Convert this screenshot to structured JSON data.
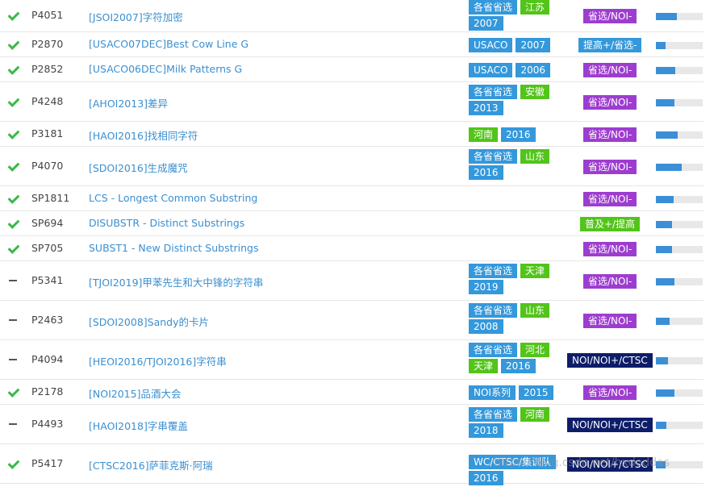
{
  "rows": [
    {
      "status": "solved",
      "id": "P4051",
      "title": "[JSOI2007]字符加密",
      "tags": [
        {
          "text": "各省省选",
          "color": "#3498db"
        },
        {
          "text": "江苏",
          "color": "#52c41a"
        },
        {
          "text": "2007",
          "color": "#3498db"
        }
      ],
      "difficulty": {
        "text": "省选/NOI-",
        "color": "#9d3dcf"
      },
      "progress": 0.45
    },
    {
      "status": "solved",
      "id": "P2870",
      "title": "[USACO07DEC]Best Cow Line G",
      "tags": [
        {
          "text": "USACO",
          "color": "#3498db"
        },
        {
          "text": "2007",
          "color": "#3498db"
        }
      ],
      "difficulty": {
        "text": "提高+/省选-",
        "color": "#3498db"
      },
      "progress": 0.2
    },
    {
      "status": "solved",
      "id": "P2852",
      "title": "[USACO06DEC]Milk Patterns G",
      "tags": [
        {
          "text": "USACO",
          "color": "#3498db"
        },
        {
          "text": "2006",
          "color": "#3498db"
        }
      ],
      "difficulty": {
        "text": "省选/NOI-",
        "color": "#9d3dcf"
      },
      "progress": 0.42
    },
    {
      "status": "solved",
      "id": "P4248",
      "title": "[AHOI2013]差异",
      "tags": [
        {
          "text": "各省省选",
          "color": "#3498db"
        },
        {
          "text": "安徽",
          "color": "#52c41a"
        },
        {
          "text": "2013",
          "color": "#3498db"
        }
      ],
      "difficulty": {
        "text": "省选/NOI-",
        "color": "#9d3dcf"
      },
      "progress": 0.4
    },
    {
      "status": "solved",
      "id": "P3181",
      "title": "[HAOI2016]找相同字符",
      "tags": [
        {
          "text": "河南",
          "color": "#52c41a"
        },
        {
          "text": "2016",
          "color": "#3498db"
        }
      ],
      "difficulty": {
        "text": "省选/NOI-",
        "color": "#9d3dcf"
      },
      "progress": 0.46
    },
    {
      "status": "solved",
      "id": "P4070",
      "title": "[SDOI2016]生成魔咒",
      "tags": [
        {
          "text": "各省省选",
          "color": "#3498db"
        },
        {
          "text": "山东",
          "color": "#52c41a"
        },
        {
          "text": "2016",
          "color": "#3498db"
        }
      ],
      "difficulty": {
        "text": "省选/NOI-",
        "color": "#9d3dcf"
      },
      "progress": 0.55
    },
    {
      "status": "solved",
      "id": "SP1811",
      "title": "LCS - Longest Common Substring",
      "tags": [],
      "difficulty": {
        "text": "省选/NOI-",
        "color": "#9d3dcf"
      },
      "progress": 0.38
    },
    {
      "status": "solved",
      "id": "SP694",
      "title": "DISUBSTR - Distinct Substrings",
      "tags": [],
      "difficulty": {
        "text": "普及+/提高",
        "color": "#52c41a"
      },
      "progress": 0.35
    },
    {
      "status": "solved",
      "id": "SP705",
      "title": "SUBST1 - New Distinct Substrings",
      "tags": [],
      "difficulty": {
        "text": "省选/NOI-",
        "color": "#9d3dcf"
      },
      "progress": 0.35
    },
    {
      "status": "pending",
      "id": "P5341",
      "title": "[TJOI2019]甲苯先生和大中锋的字符串",
      "tags": [
        {
          "text": "各省省选",
          "color": "#3498db"
        },
        {
          "text": "天津",
          "color": "#52c41a"
        },
        {
          "text": "2019",
          "color": "#3498db"
        }
      ],
      "difficulty": {
        "text": "省选/NOI-",
        "color": "#9d3dcf"
      },
      "progress": 0.4
    },
    {
      "status": "pending",
      "id": "P2463",
      "title": "[SDOI2008]Sandy的卡片",
      "tags": [
        {
          "text": "各省省选",
          "color": "#3498db"
        },
        {
          "text": "山东",
          "color": "#52c41a"
        },
        {
          "text": "2008",
          "color": "#3498db"
        }
      ],
      "difficulty": {
        "text": "省选/NOI-",
        "color": "#9d3dcf"
      },
      "progress": 0.3
    },
    {
      "status": "pending",
      "id": "P4094",
      "title": "[HEOI2016/TJOI2016]字符串",
      "tags": [
        {
          "text": "各省省选",
          "color": "#3498db"
        },
        {
          "text": "河北",
          "color": "#52c41a"
        },
        {
          "text": "天津",
          "color": "#52c41a"
        },
        {
          "text": "2016",
          "color": "#3498db"
        }
      ],
      "difficulty": {
        "text": "NOI/NOI+/CTSC",
        "color": "#0e1d69"
      },
      "progress": 0.25
    },
    {
      "status": "solved",
      "id": "P2178",
      "title": "[NOI2015]品酒大会",
      "tags": [
        {
          "text": "NOI系列",
          "color": "#3498db"
        },
        {
          "text": "2015",
          "color": "#3498db"
        }
      ],
      "difficulty": {
        "text": "省选/NOI-",
        "color": "#9d3dcf"
      },
      "progress": 0.4
    },
    {
      "status": "pending",
      "id": "P4493",
      "title": "[HAOI2018]字串覆盖",
      "tags": [
        {
          "text": "各省省选",
          "color": "#3498db"
        },
        {
          "text": "河南",
          "color": "#52c41a"
        },
        {
          "text": "2018",
          "color": "#3498db"
        }
      ],
      "difficulty": {
        "text": "NOI/NOI+/CTSC",
        "color": "#0e1d69"
      },
      "progress": 0.22
    },
    {
      "status": "solved",
      "id": "P5417",
      "title": "[CTSC2016]萨菲克斯·阿瑞",
      "tags": [
        {
          "text": "WC/CTSC/集训队",
          "color": "#3498db"
        },
        {
          "text": "2016",
          "color": "#3498db"
        }
      ],
      "difficulty": {
        "text": "NOI/NOI+/CTSC",
        "color": "#0e1d69"
      },
      "progress": 0.2
    }
  ],
  "watermark": "https://blog.csdn.net/hxdoddas"
}
